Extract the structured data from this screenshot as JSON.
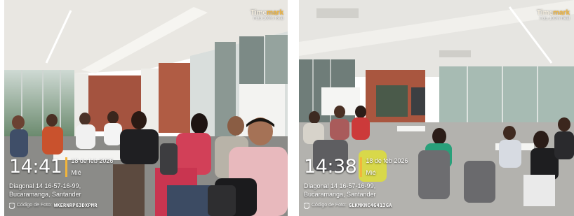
{
  "photos": [
    {
      "watermark": {
        "logo_a": "Time",
        "logo_b": "mark",
        "sub": "Foto 100% Real"
      },
      "stamp": {
        "time": "14:41",
        "date": "18 de feb 2026",
        "weekday": "Mié",
        "address_line1": "Diagonal 14 16-57-16-99,",
        "address_line2": "Bucaramanga, Santander",
        "code_label": "Código de Foto:",
        "code_value": "WKERNRP63DXPMR"
      }
    },
    {
      "watermark": {
        "logo_a": "Time",
        "logo_b": "mark",
        "sub": "Foto 100% Real"
      },
      "stamp": {
        "time": "14:38",
        "date": "18 de feb 2026",
        "weekday": "Mié",
        "address_line1": "Diagonal 14 16-57-16-99,",
        "address_line2": "Bucaramanga, Santander",
        "code_label": "Código de Foto:",
        "code_value": "GLKMKNC4G413GA"
      }
    }
  ],
  "colors": {
    "accent": "#f2b53b",
    "text": "#ffffff"
  }
}
